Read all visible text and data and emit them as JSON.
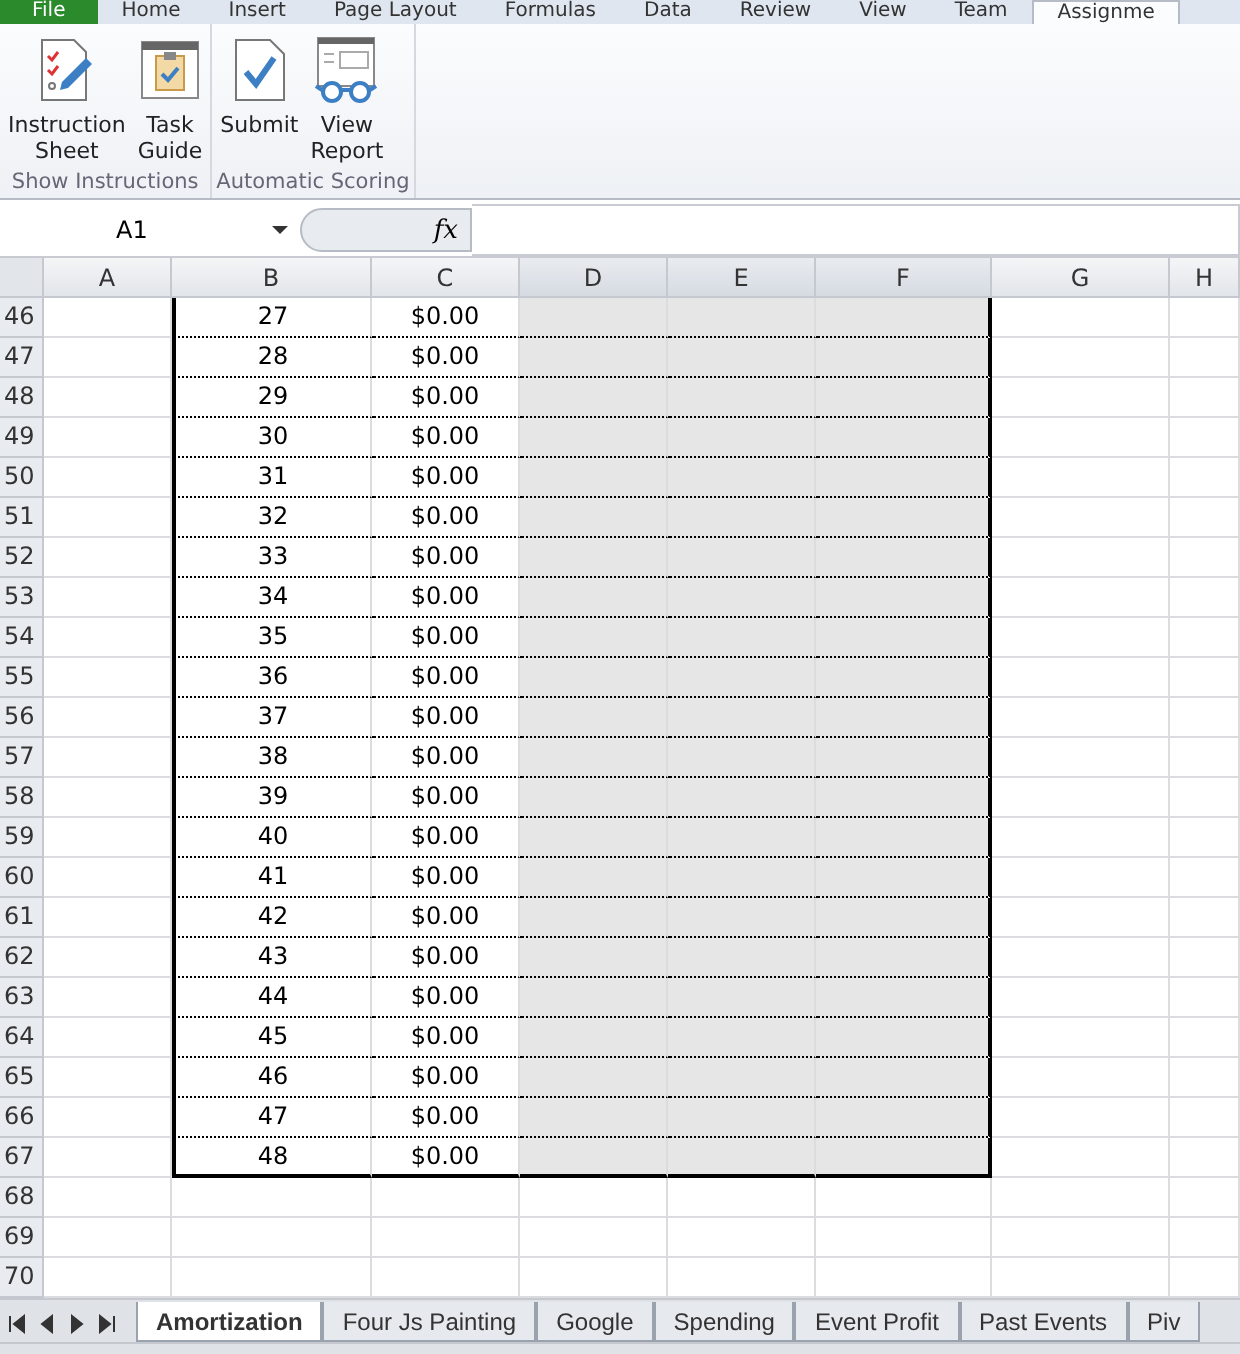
{
  "menu_tabs": [
    {
      "label": "File",
      "kind": "file",
      "selected": false
    },
    {
      "label": "Home",
      "kind": "tab",
      "selected": false
    },
    {
      "label": "Insert",
      "kind": "tab",
      "selected": false
    },
    {
      "label": "Page Layout",
      "kind": "tab",
      "selected": false
    },
    {
      "label": "Formulas",
      "kind": "tab",
      "selected": false
    },
    {
      "label": "Data",
      "kind": "tab",
      "selected": false
    },
    {
      "label": "Review",
      "kind": "tab",
      "selected": false
    },
    {
      "label": "View",
      "kind": "tab",
      "selected": false
    },
    {
      "label": "Team",
      "kind": "tab",
      "selected": false
    },
    {
      "label": "Assignme",
      "kind": "tab",
      "selected": true
    }
  ],
  "ribbon_groups": [
    {
      "label": "Show Instructions",
      "buttons": [
        {
          "label": "Instruction Sheet",
          "kind": "checklist"
        },
        {
          "label": "Task Guide",
          "kind": "clipboard"
        }
      ]
    },
    {
      "label": "Automatic Scoring",
      "buttons": [
        {
          "label": "Submit",
          "kind": "document"
        },
        {
          "label": "View Report",
          "kind": "report"
        }
      ]
    }
  ],
  "formula_bar": {
    "name_box": "A1",
    "function_label": "fx"
  },
  "columns": [
    "A",
    "B",
    "C",
    "D",
    "E",
    "F",
    "G",
    "H"
  ],
  "rows": [
    {
      "row": "46",
      "b": "27",
      "c": "$0.00",
      "shaded": true
    },
    {
      "row": "47",
      "b": "28",
      "c": "$0.00",
      "shaded": true
    },
    {
      "row": "48",
      "b": "29",
      "c": "$0.00",
      "shaded": true
    },
    {
      "row": "49",
      "b": "30",
      "c": "$0.00",
      "shaded": true
    },
    {
      "row": "50",
      "b": "31",
      "c": "$0.00",
      "shaded": true
    },
    {
      "row": "51",
      "b": "32",
      "c": "$0.00",
      "shaded": true
    },
    {
      "row": "52",
      "b": "33",
      "c": "$0.00",
      "shaded": true
    },
    {
      "row": "53",
      "b": "34",
      "c": "$0.00",
      "shaded": true
    },
    {
      "row": "54",
      "b": "35",
      "c": "$0.00",
      "shaded": true
    },
    {
      "row": "55",
      "b": "36",
      "c": "$0.00",
      "shaded": true
    },
    {
      "row": "56",
      "b": "37",
      "c": "$0.00",
      "shaded": true
    },
    {
      "row": "57",
      "b": "38",
      "c": "$0.00",
      "shaded": true
    },
    {
      "row": "58",
      "b": "39",
      "c": "$0.00",
      "shaded": true
    },
    {
      "row": "59",
      "b": "40",
      "c": "$0.00",
      "shaded": true
    },
    {
      "row": "60",
      "b": "41",
      "c": "$0.00",
      "shaded": true
    },
    {
      "row": "61",
      "b": "42",
      "c": "$0.00",
      "shaded": true
    },
    {
      "row": "62",
      "b": "43",
      "c": "$0.00",
      "shaded": true
    },
    {
      "row": "63",
      "b": "44",
      "c": "$0.00",
      "shaded": true
    },
    {
      "row": "64",
      "b": "45",
      "c": "$0.00",
      "shaded": true
    },
    {
      "row": "65",
      "b": "46",
      "c": "$0.00",
      "shaded": true
    },
    {
      "row": "66",
      "b": "47",
      "c": "$0.00",
      "shaded": true
    },
    {
      "row": "67",
      "b": "48",
      "c": "$0.00",
      "shaded": true
    },
    {
      "row": "68",
      "shaded": false
    },
    {
      "row": "69",
      "shaded": false
    },
    {
      "row": "70",
      "shaded": false
    }
  ],
  "sheet_tabs": [
    {
      "label": "Amortization",
      "selected": true
    },
    {
      "label": "Four Js Painting",
      "selected": false
    },
    {
      "label": "Google",
      "selected": false
    },
    {
      "label": "Spending",
      "selected": false
    },
    {
      "label": "Event Profit",
      "selected": false
    },
    {
      "label": "Past Events",
      "selected": false
    },
    {
      "label": "Piv",
      "selected": false
    }
  ]
}
